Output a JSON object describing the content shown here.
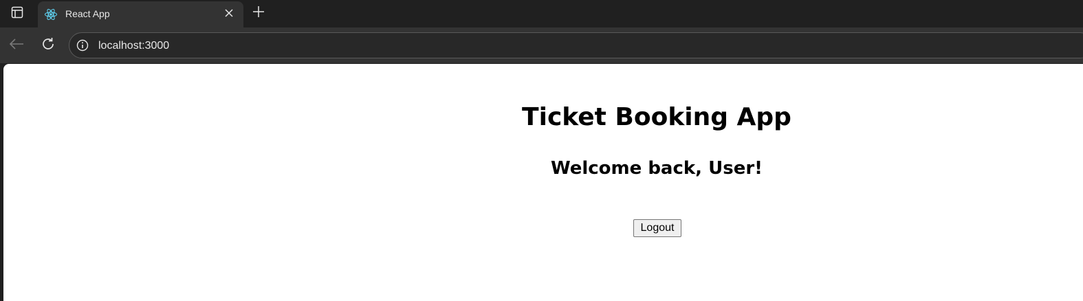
{
  "browser": {
    "tab": {
      "title": "React App",
      "favicon": "react-logo-icon"
    },
    "address_bar": {
      "url": "localhost:3000"
    },
    "icons": {
      "tab_actions": "tab-actions-icon",
      "close_tab": "close-icon",
      "new_tab": "plus-icon",
      "back": "back-arrow-icon",
      "reload": "reload-icon",
      "site_info": "info-icon"
    },
    "colors": {
      "chrome_dark": "#202020",
      "toolbar": "#333333",
      "react_blue": "#61dafb"
    }
  },
  "page": {
    "title": "Ticket Booking App",
    "welcome": "Welcome back, User!",
    "logout_label": "Logout"
  }
}
